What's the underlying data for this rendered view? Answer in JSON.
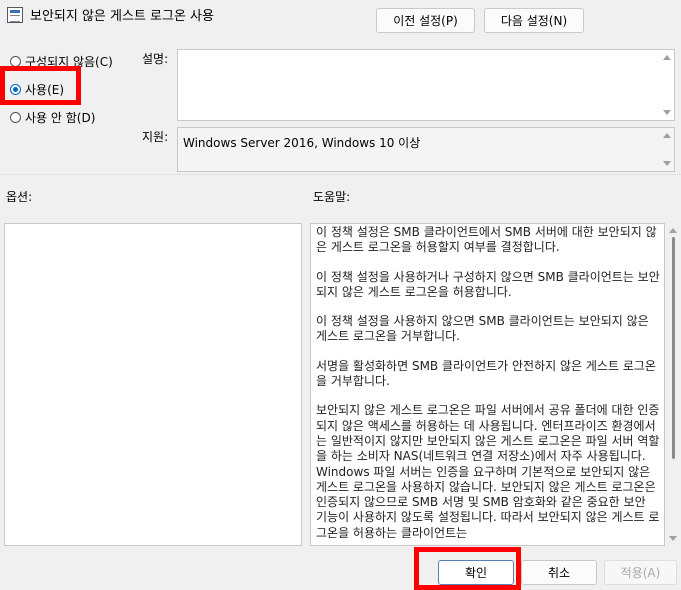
{
  "window": {
    "title": "보안되지 않은 게스트 로그온 사용",
    "icon": "policy-icon"
  },
  "nav": {
    "prev_label": "이전 설정(P)",
    "next_label": "다음 설정(N)"
  },
  "options": {
    "not_configured_label": "구성되지 않음(C)",
    "enabled_label": "사용(E)",
    "disabled_label": "사용 안 함(D)",
    "selected": "enabled"
  },
  "comment": {
    "label": "설명:",
    "value": ""
  },
  "supported": {
    "label": "지원:",
    "value": "Windows Server 2016, Windows 10 이상"
  },
  "sections": {
    "options_label": "옵션:",
    "help_label": "도움말:"
  },
  "help": {
    "paragraphs": [
      "이 정책 설정은 SMB 클라이언트에서 SMB 서버에 대한 보안되지 않은 게스트 로그온을 허용할지 여부를 결정합니다.",
      "이 정책 설정을 사용하거나 구성하지 않으면 SMB 클라이언트는 보안되지 않은 게스트 로그온을 허용합니다.",
      "이 정책 설정을 사용하지 않으면 SMB 클라이언트는 보안되지 않은 게스트 로그온을 거부합니다.",
      "서명을 활성화하면 SMB 클라이언트가 안전하지 않은 게스트 로그온을 거부합니다.",
      "보안되지 않은 게스트 로그온은 파일 서버에서 공유 폴더에 대한 인증되지 않은 액세스를 허용하는 데 사용됩니다. 엔터프라이즈 환경에서는 일반적이지 않지만 보안되지 않은 게스트 로그온은 파일 서버 역할을 하는 소비자 NAS(네트워크 연결 저장소)에서 자주 사용됩니다. Windows 파일 서버는 인증을 요구하며 기본적으로 보안되지 않은 게스트 로그온을 사용하지 않습니다. 보안되지 않은 게스트 로그온은 인증되지 않으므로 SMB 서명 및 SMB 암호화와 같은 중요한 보안 기능이 사용하지 않도록 설정됩니다. 따라서 보안되지 않은 게스트 로그온을 허용하는 클라이언트는"
    ]
  },
  "footer": {
    "ok_label": "확인",
    "cancel_label": "취소",
    "apply_label": "적용(A)"
  },
  "colors": {
    "highlight": "#ff0000",
    "accent": "#0067c0"
  }
}
